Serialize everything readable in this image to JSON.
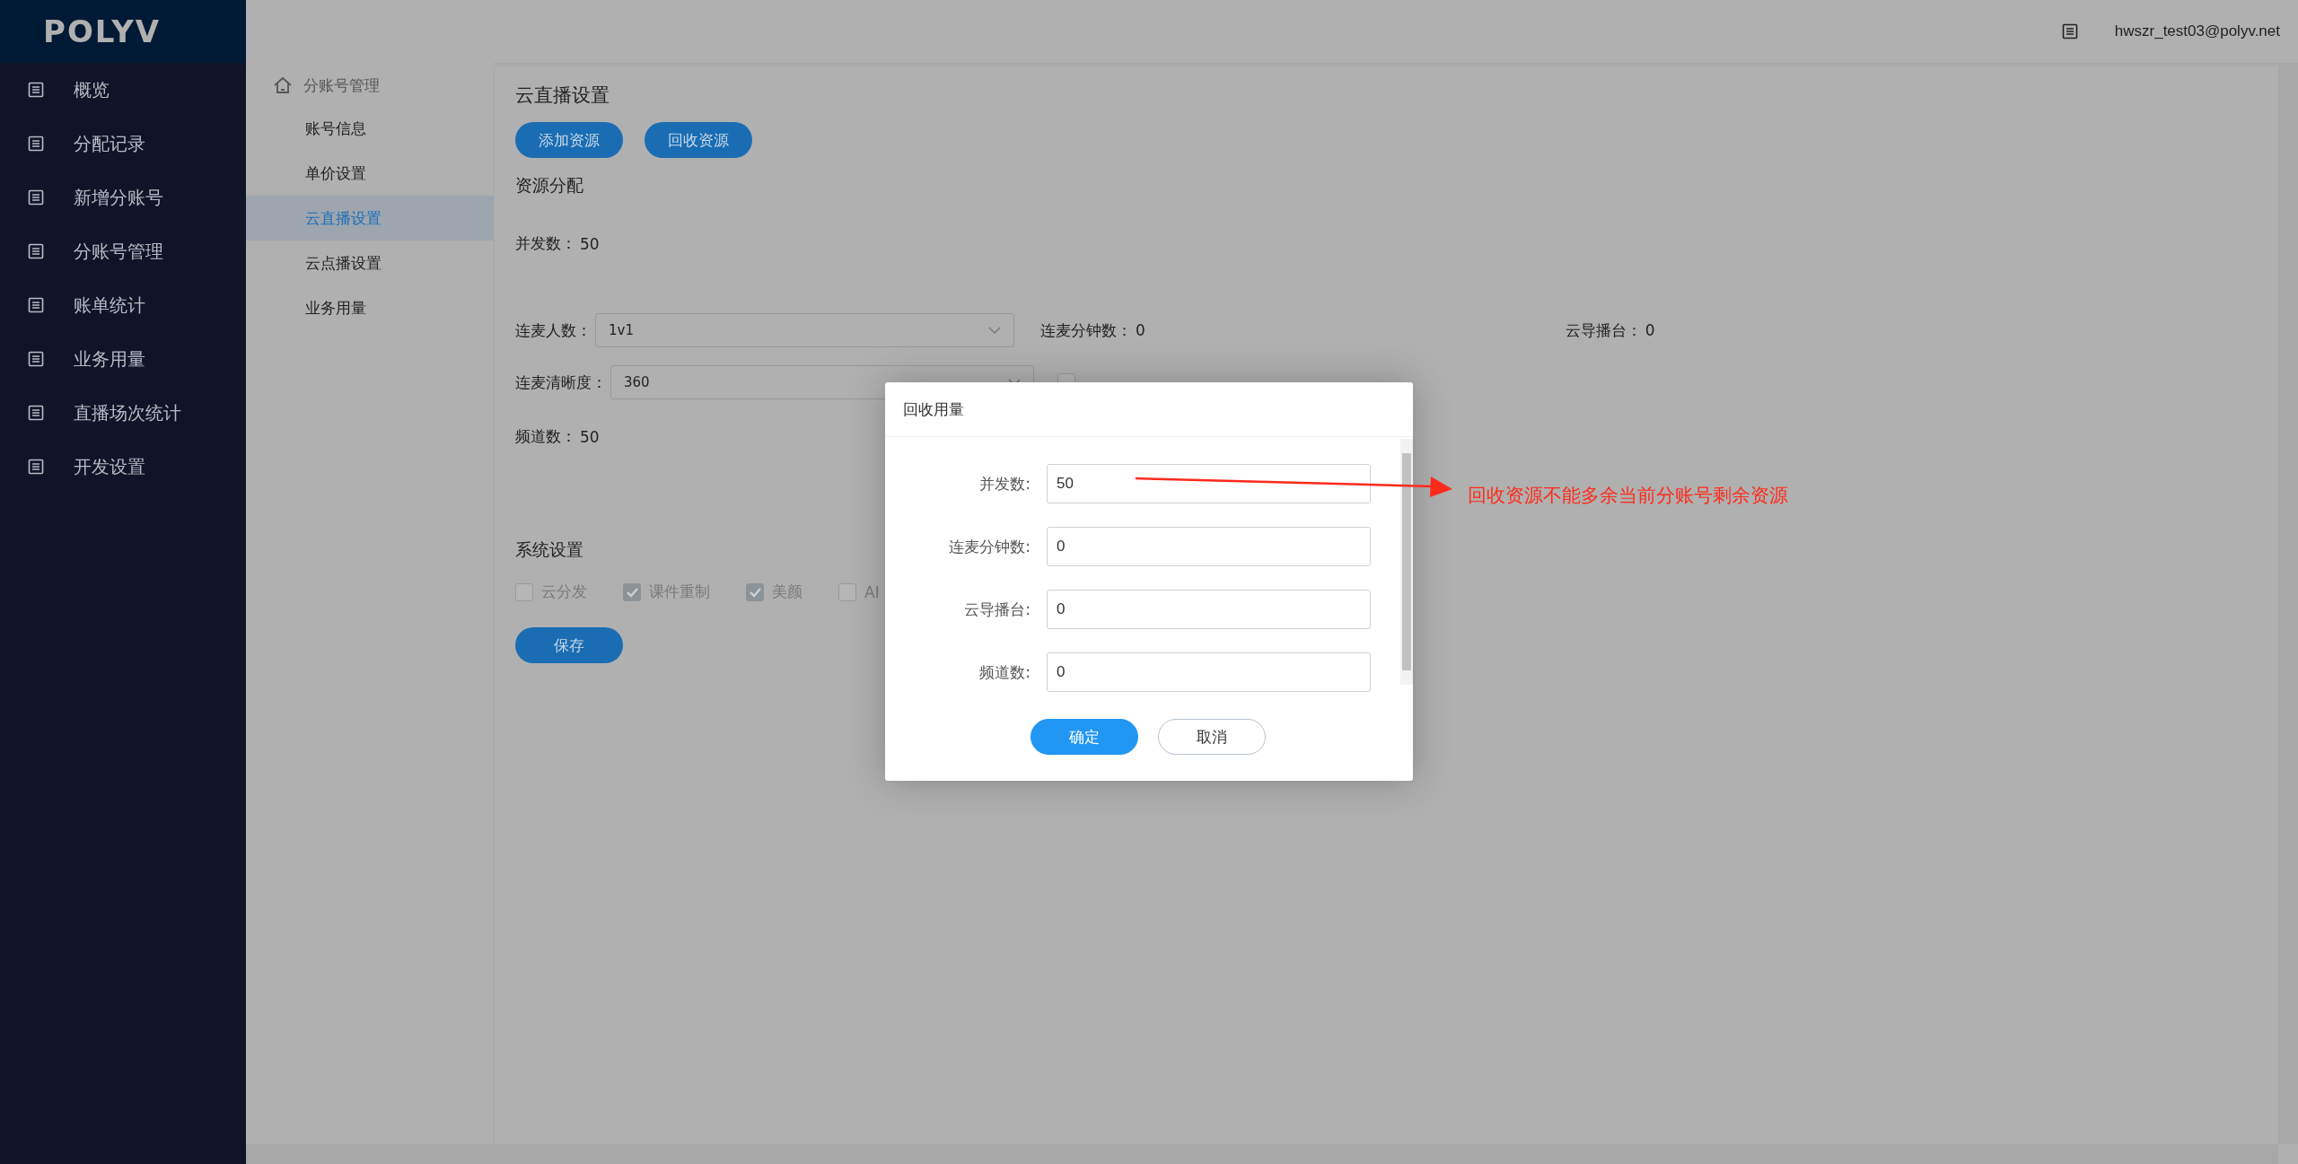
{
  "logo": "POLYV",
  "header": {
    "user": "hwszr_test03@polyv.net"
  },
  "sidebar": {
    "items": [
      {
        "label": "概览"
      },
      {
        "label": "分配记录"
      },
      {
        "label": "新增分账号"
      },
      {
        "label": "分账号管理"
      },
      {
        "label": "账单统计"
      },
      {
        "label": "业务用量"
      },
      {
        "label": "直播场次统计"
      },
      {
        "label": "开发设置"
      }
    ]
  },
  "subnav": {
    "title": "分账号管理",
    "items": [
      {
        "label": "账号信息",
        "selected": false
      },
      {
        "label": "单价设置",
        "selected": false
      },
      {
        "label": "云直播设置",
        "selected": true
      },
      {
        "label": "云点播设置",
        "selected": false
      },
      {
        "label": "业务用量",
        "selected": false
      }
    ]
  },
  "page": {
    "title": "云直播设置",
    "buttons": [
      "添加资源",
      "回收资源"
    ],
    "section_title": "资源分配",
    "concurrency": {
      "label": "并发数：",
      "value": "50"
    },
    "mic_count": {
      "label": "连麦人数：",
      "value": "1v1"
    },
    "mic_minutes": {
      "label": "连麦分钟数：",
      "value": "0"
    },
    "director": {
      "label": "云导播台：",
      "value": "0"
    },
    "mic_resolution": {
      "label": "连麦清晰度：",
      "value": "360"
    },
    "mix": {
      "checked": false
    },
    "channels": {
      "label": "频道数：",
      "value": "50"
    },
    "system": {
      "title": "系统设置",
      "options": [
        {
          "label": "云分发",
          "checked": false
        },
        {
          "label": "课件重制",
          "checked": true
        },
        {
          "label": "美颜",
          "checked": true
        },
        {
          "label": "AI",
          "checked": false
        }
      ]
    },
    "save_button": "保存"
  },
  "dialog": {
    "title": "回收用量",
    "fields": [
      {
        "label": "并发数:",
        "value": "50"
      },
      {
        "label": "连麦分钟数:",
        "value": "0"
      },
      {
        "label": "云导播台:",
        "value": "0"
      },
      {
        "label": "频道数:",
        "value": "0"
      }
    ],
    "buttons": [
      {
        "label": "确定",
        "kind": "primary"
      },
      {
        "label": "取消",
        "kind": "secondary"
      }
    ]
  },
  "annotation": {
    "text": "回收资源不能多余当前分账号剩余资源"
  }
}
